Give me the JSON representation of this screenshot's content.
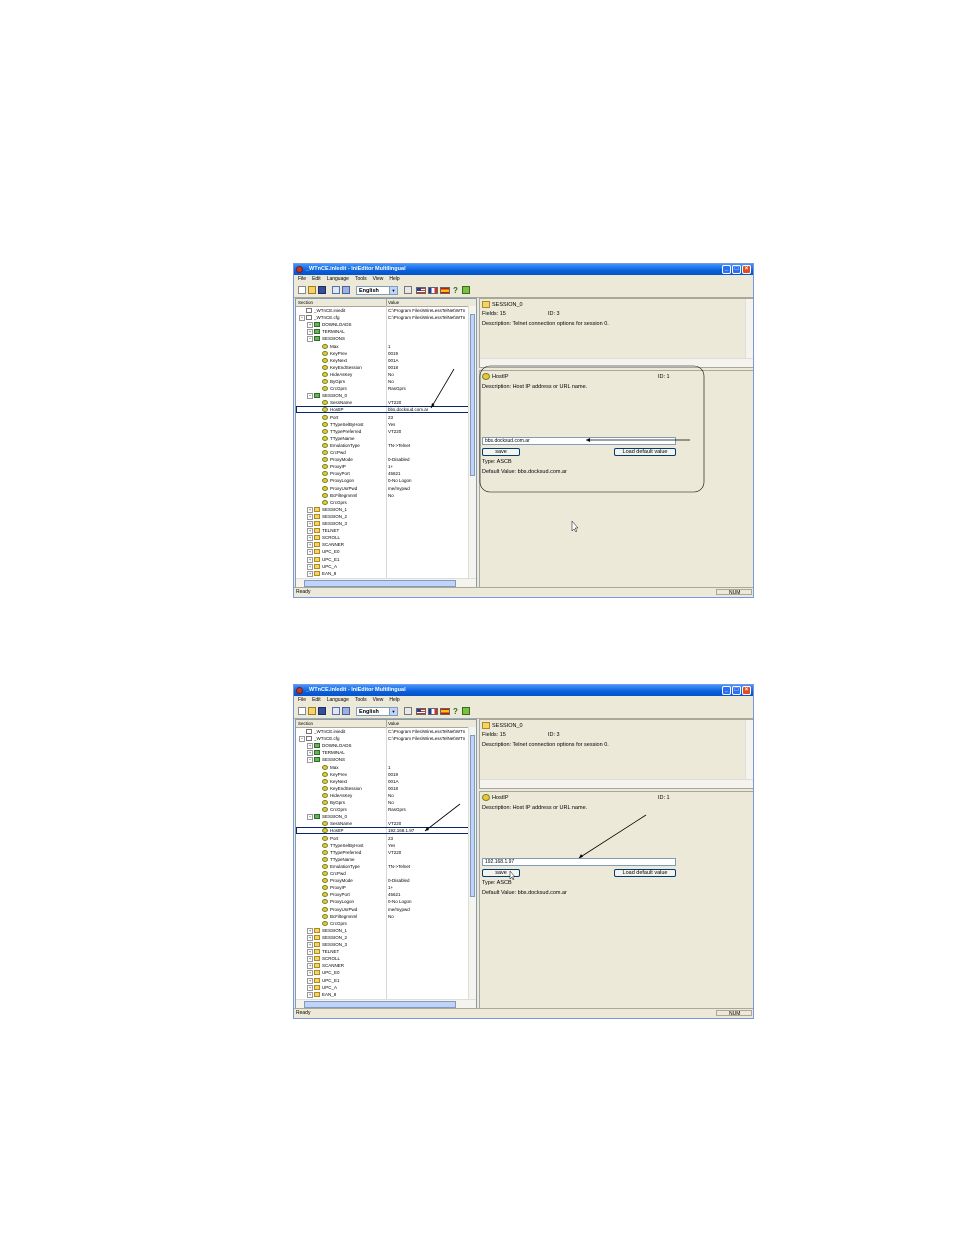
{
  "app": {
    "window_title": "_WTnCE.inIedit - IniEditor MultiIingual",
    "menu": [
      "File",
      "Edit",
      "Language",
      "Tools",
      "View",
      "Help"
    ],
    "language_selected": "English",
    "status_text": "Ready",
    "status_num": "NUM"
  },
  "tree": {
    "col_section": "Section",
    "col_value": "Value",
    "rows": [
      {
        "label": "_WTnCE.iniedit",
        "value": "C:\\Program Files\\WireLessTelNet\\WTn",
        "icon": "file"
      },
      {
        "label": "_WTnCE.cfg",
        "value": "C:\\Program Files\\WireLessTelNet\\WTn",
        "icon": "file"
      },
      {
        "label": "DOWNLOADS",
        "value": "",
        "icon": "folder-green"
      },
      {
        "label": "TERMINAL",
        "value": "",
        "icon": "folder-green"
      },
      {
        "label": "SESSIONS",
        "value": "",
        "icon": "folder-green"
      },
      {
        "label": "Max",
        "value": "1",
        "icon": "key"
      },
      {
        "label": "KeyPrev",
        "value": "0019",
        "icon": "key"
      },
      {
        "label": "KeyNext",
        "value": "001A",
        "icon": "key"
      },
      {
        "label": "KeyEndSession",
        "value": "0018",
        "icon": "key"
      },
      {
        "label": "HideAsKey",
        "value": "No",
        "icon": "key"
      },
      {
        "label": "ByGprs",
        "value": "No",
        "icon": "key"
      },
      {
        "label": "CrcGprs",
        "value": "RasGprs",
        "icon": "key"
      },
      {
        "label": "SESSION_0",
        "value": "",
        "icon": "folder-green"
      },
      {
        "label": "SessName",
        "value": "VT220",
        "icon": "key"
      },
      {
        "label": "HostIP",
        "value": "bbs.docksud.com.ar",
        "icon": "key"
      },
      {
        "label": "Port",
        "value": "23",
        "icon": "key"
      },
      {
        "label": "TTypeSelByHost",
        "value": "Yes",
        "icon": "key"
      },
      {
        "label": "TTypePreferred",
        "value": "VT220",
        "icon": "key"
      },
      {
        "label": "TTypeName",
        "value": "",
        "icon": "key"
      },
      {
        "label": "EmulationType",
        "value": "TN->Telnet",
        "icon": "key"
      },
      {
        "label": "CrcPwd",
        "value": "",
        "icon": "key"
      },
      {
        "label": "ProxyMode",
        "value": "0-Disabled",
        "icon": "key"
      },
      {
        "label": "ProxyIP",
        "value": "1+",
        "icon": "key"
      },
      {
        "label": "ProxyPort",
        "value": "45621",
        "icon": "key"
      },
      {
        "label": "ProxyLogon",
        "value": "0-No Logon",
        "icon": "key"
      },
      {
        "label": "ProxyUsrPwd",
        "value": "me/mypwd",
        "icon": "key"
      },
      {
        "label": "BcFiltegmnml",
        "value": "No",
        "icon": "key"
      },
      {
        "label": "CrcGprs",
        "value": "",
        "icon": "key"
      },
      {
        "label": "SESSION_1",
        "value": "",
        "icon": "folder"
      },
      {
        "label": "SESSION_2",
        "value": "",
        "icon": "folder"
      },
      {
        "label": "SESSION_3",
        "value": "",
        "icon": "folder"
      },
      {
        "label": "TELNET",
        "value": "",
        "icon": "folder"
      },
      {
        "label": "SCROLL",
        "value": "",
        "icon": "folder"
      },
      {
        "label": "SCANNER",
        "value": "",
        "icon": "folder"
      },
      {
        "label": "UPC_E0",
        "value": "",
        "icon": "folder"
      },
      {
        "label": "UPC_E1",
        "value": "",
        "icon": "folder"
      },
      {
        "label": "UPC_A",
        "value": "",
        "icon": "folder"
      },
      {
        "label": "EAN_8",
        "value": "",
        "icon": "folder"
      }
    ]
  },
  "section_info": {
    "name": "SESSION_0",
    "fields": "Fields: 15",
    "id": "ID: 3",
    "description": "Description: Telnet connection options for session 0."
  },
  "key_info": {
    "name": "HostIP",
    "id": "ID: 1",
    "description": "Description: Host IP address or URL name.",
    "save_label": "save",
    "load_default_label": "Load default value",
    "type": "Type: ASCB",
    "default_value": "Default Value: bbs.docksud.com.ar"
  },
  "screenshots": [
    {
      "hostip_value": "bbs.docksud.com.ar",
      "input_value": "bbs.docksud.com.ar"
    },
    {
      "hostip_value": "192.168.1.97",
      "input_value": "192.168.1.97"
    }
  ]
}
